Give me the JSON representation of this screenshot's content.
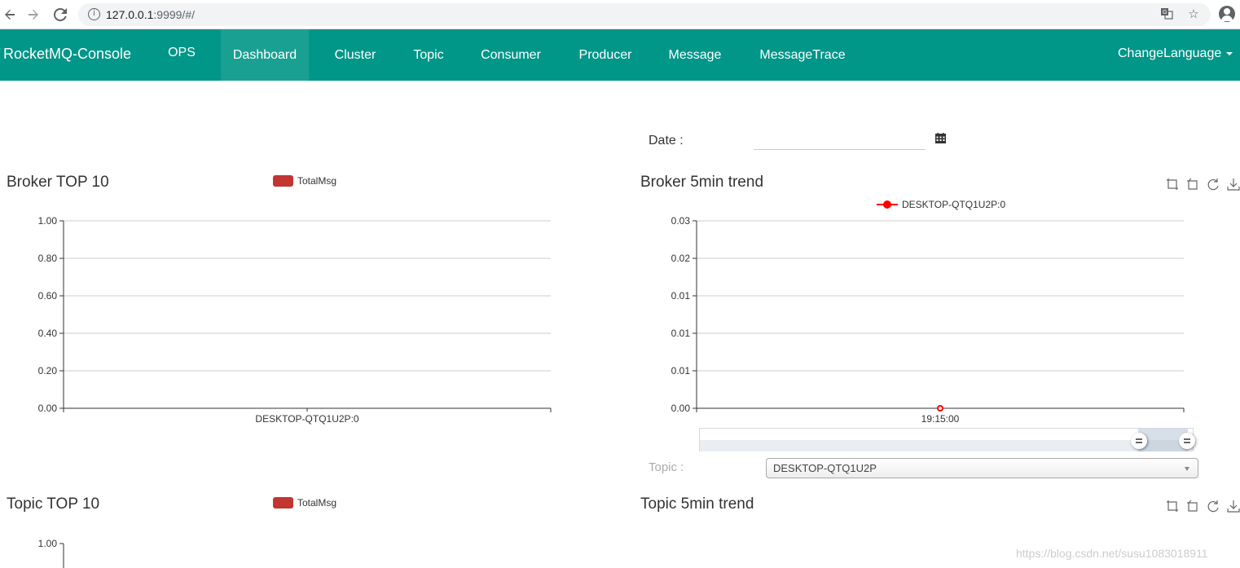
{
  "browser": {
    "url_host": "127.0.0.1",
    "url_rest": ":9999/#/",
    "icons": [
      "back-arrow-icon",
      "forward-arrow-icon",
      "reload-icon",
      "info-icon",
      "translate-icon",
      "star-icon",
      "profile-icon"
    ]
  },
  "nav": {
    "brand": "RocketMQ-Console",
    "items": [
      {
        "label": "OPS",
        "active": false
      },
      {
        "label": "Dashboard",
        "active": true
      },
      {
        "label": "Cluster",
        "active": false
      },
      {
        "label": "Topic",
        "active": false
      },
      {
        "label": "Consumer",
        "active": false
      },
      {
        "label": "Producer",
        "active": false
      },
      {
        "label": "Message",
        "active": false
      },
      {
        "label": "MessageTrace",
        "active": false
      }
    ],
    "change_language": "ChangeLanguage",
    "color": "#009688",
    "active_color": "#1aa092"
  },
  "date": {
    "label": "Date :",
    "value": "",
    "icon": "calendar-icon"
  },
  "panels": {
    "broker_top": {
      "title": "Broker TOP 10",
      "legend": "TotalMsg"
    },
    "broker_trend": {
      "title": "Broker 5min trend",
      "legend": "DESKTOP-QTQ1U2P:0"
    },
    "topic_top": {
      "title": "Topic TOP 10",
      "legend": "TotalMsg"
    },
    "topic_trend": {
      "title": "Topic 5min trend"
    }
  },
  "toolbox": [
    "zoom-icon",
    "zoom-reset-icon",
    "restore-icon",
    "download-icon"
  ],
  "topic_select": {
    "label": "Topic :",
    "value": "DESKTOP-QTQ1U2P"
  },
  "watermark": "https://blog.csdn.net/susu1083018911",
  "chart_data": [
    {
      "type": "bar",
      "title": "Broker TOP 10",
      "categories": [
        "DESKTOP-QTQ1U2P:0"
      ],
      "series": [
        {
          "name": "TotalMsg",
          "values": [
            0
          ]
        }
      ],
      "yticks": [
        "0.00",
        "0.20",
        "0.40",
        "0.60",
        "0.80",
        "1.00"
      ],
      "ylim": [
        0,
        1
      ],
      "color": "#c23531",
      "grid": true
    },
    {
      "type": "line",
      "title": "Broker 5min trend",
      "x": [
        "19:15:00"
      ],
      "series": [
        {
          "name": "DESKTOP-QTQ1U2P:0",
          "values": [
            0
          ]
        }
      ],
      "yticks": [
        "0.00",
        "0.01",
        "0.01",
        "0.01",
        "0.02",
        "0.03"
      ],
      "ylim": [
        0,
        0.03
      ],
      "color": "#ff0000",
      "grid": true,
      "datazoom": {
        "start": 90,
        "end": 100
      }
    },
    {
      "type": "bar",
      "title": "Topic TOP 10",
      "categories": [],
      "series": [
        {
          "name": "TotalMsg",
          "values": []
        }
      ],
      "yticks": [
        "1.00"
      ],
      "ylim": [
        0,
        1
      ],
      "color": "#c23531",
      "grid": true
    }
  ]
}
